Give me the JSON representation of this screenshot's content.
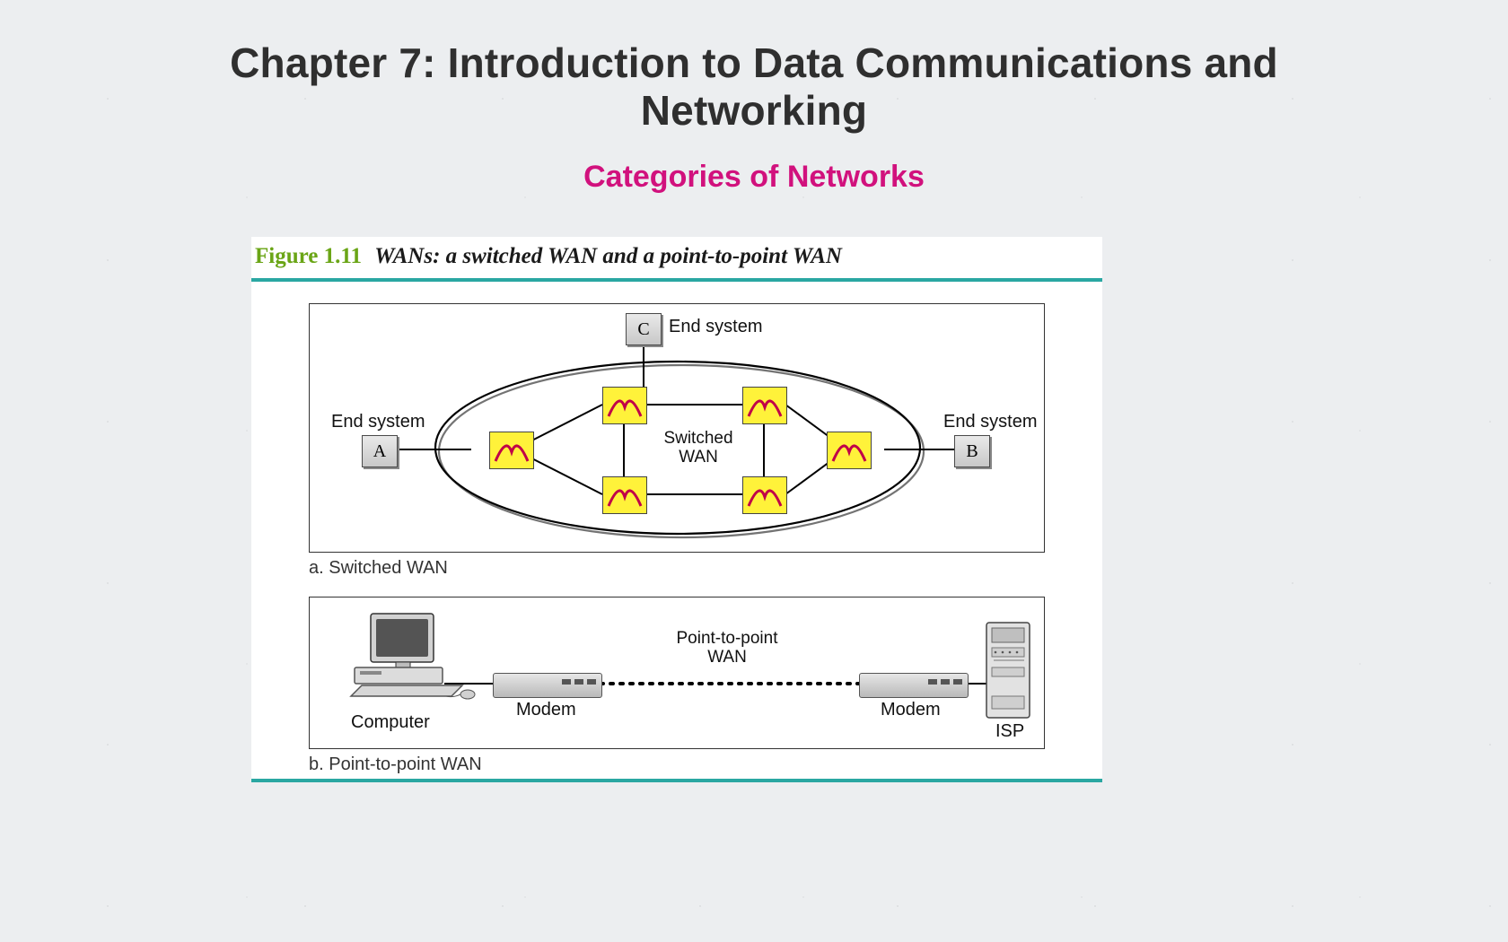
{
  "title_line1": "Chapter 7: Introduction to Data Communications and",
  "title_line2": "Networking",
  "subtitle": "Categories of Networks",
  "figure": {
    "number": "Figure 1.11",
    "caption": "WANs: a switched WAN and a point-to-point WAN"
  },
  "panel_a": {
    "caption": "a. Switched WAN",
    "endsystems": {
      "A": {
        "letter": "A",
        "label_left": "End system"
      },
      "B": {
        "letter": "B",
        "label_right": "End system"
      },
      "C": {
        "letter": "C",
        "label_right": "End system"
      }
    },
    "center_label_line1": "Switched",
    "center_label_line2": "WAN"
  },
  "panel_b": {
    "caption": "b. Point-to-point WAN",
    "link_label_line1": "Point-to-point",
    "link_label_line2": "WAN",
    "left_device": "Computer",
    "modem_label": "Modem",
    "right_device": "ISP"
  }
}
